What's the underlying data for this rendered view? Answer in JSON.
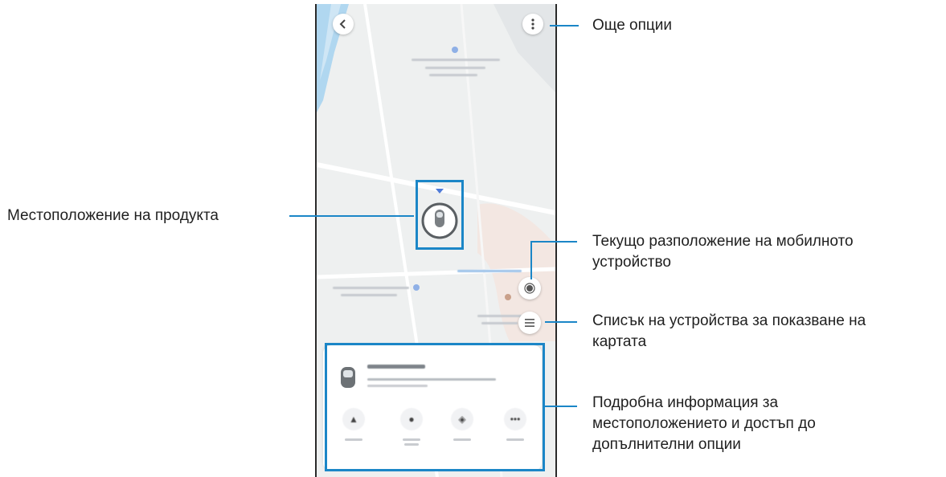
{
  "callouts": {
    "more_options": "Още опции",
    "product_location": "Местоположение на продукта",
    "current_location_line1": "Текущо разположение на мобилното",
    "current_location_line2": "устройство",
    "device_list_line1": "Списък на устройства за показване на",
    "device_list_line2": "картата",
    "details_line1": "Подробна информация за",
    "details_line2": "местоположението и достъп до",
    "details_line3": "допълнителни опции"
  },
  "icons": {
    "back": "back-arrow-icon",
    "more": "more-options-icon",
    "product_pin": "product-location-pin-icon",
    "my_location": "my-location-icon",
    "device_list": "device-list-icon",
    "tag": "smarttag-icon"
  },
  "colors": {
    "accent": "#1b86c7",
    "map_background": "#eef0f0",
    "map_water": "#a8d4f0"
  }
}
